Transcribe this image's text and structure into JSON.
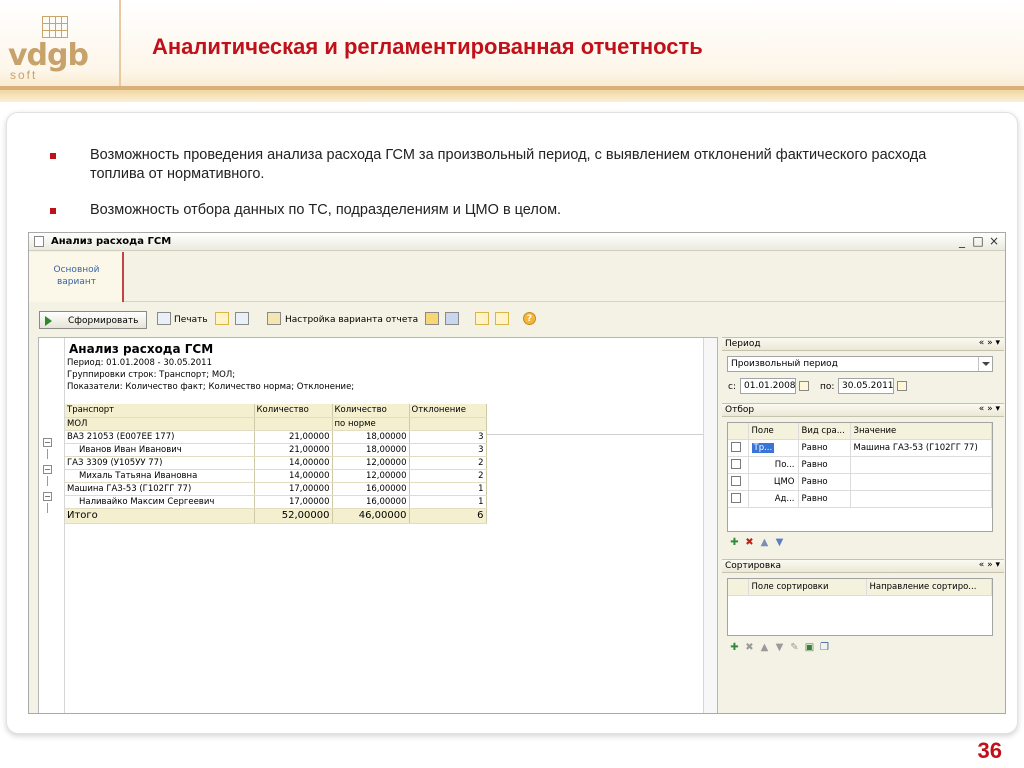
{
  "slide": {
    "title": "Аналитическая и регламентированная отчетность",
    "page_number": "36",
    "accent_color": "#c0111a",
    "logo": {
      "text": "vdgb",
      "sub": "soft"
    },
    "bullets": [
      "Возможность проведения анализа расхода ГСМ за произвольный период, с выявлением отклонений фактического расхода топлива от нормативного.",
      "Возможность отбора данных по ТС, подразделениям и ЦМО в целом."
    ]
  },
  "window": {
    "title": "Анализ расхода ГСМ",
    "controls": [
      "_",
      "□",
      "×"
    ],
    "variant_tab": {
      "line1": "Основной",
      "line2": "вариант"
    },
    "toolbar": {
      "generate": "Сформировать",
      "print": "Печать",
      "settings": "Настройка варианта отчета",
      "help": "?"
    }
  },
  "report": {
    "title": "Анализ расхода ГСМ",
    "meta": [
      "Период: 01.01.2008 - 30.05.2011",
      "Группировки строк: Транспорт; МОЛ;",
      "Показатели: Количество факт; Количество норма; Отклонение;"
    ],
    "header": {
      "col1_line1": "Транспорт",
      "col1_line2": "МОЛ",
      "col2_line1": "Количество",
      "col3_line1": "Количество",
      "col3_line2": "по норме",
      "col4_line1": "Отклонение"
    },
    "rows": [
      {
        "name": "ВАЗ 21053 (Е007ЕЕ 177)",
        "fact": "21,00000",
        "norm": "18,00000",
        "dev": "3"
      },
      {
        "name": "Иванов Иван Иванович",
        "fact": "21,00000",
        "norm": "18,00000",
        "dev": "3"
      },
      {
        "name": "ГАЗ 3309 (У105УУ 77)",
        "fact": "14,00000",
        "norm": "12,00000",
        "dev": "2"
      },
      {
        "name": "Михаль Татьяна Ивановна",
        "fact": "14,00000",
        "norm": "12,00000",
        "dev": "2"
      },
      {
        "name": "Машина ГАЗ-53 (Г102ГГ 77)",
        "fact": "17,00000",
        "norm": "16,00000",
        "dev": "1"
      },
      {
        "name": "Наливайко Максим Сергеевич",
        "fact": "17,00000",
        "norm": "16,00000",
        "dev": "1"
      }
    ],
    "total": {
      "name": "Итого",
      "fact": "52,00000",
      "norm": "46,00000",
      "dev": "6"
    }
  },
  "settings": {
    "period": {
      "title": "Период",
      "nav": "« » ▾",
      "type": "Произвольный период",
      "from_label": "с:",
      "from": "01.01.2008",
      "to_label": "по:",
      "to": "30.05.2011"
    },
    "filter": {
      "title": "Отбор",
      "nav": "« » ▾",
      "columns": [
        "Поле",
        "Вид сра...",
        "Значение"
      ],
      "rows": [
        {
          "field": "Тр...",
          "kind": "Равно",
          "value": "Машина ГАЗ-53 (Г102ГГ 77)"
        },
        {
          "field": "По...",
          "kind": "Равно",
          "value": ""
        },
        {
          "field": "ЦМО",
          "kind": "Равно",
          "value": ""
        },
        {
          "field": "Ад...",
          "kind": "Равно",
          "value": ""
        }
      ],
      "actions": [
        "add-icon",
        "delete-icon",
        "up-icon",
        "down-icon"
      ]
    },
    "sort": {
      "title": "Сортировка",
      "nav": "« » ▾",
      "columns": [
        "Поле сортировки",
        "Направление сортиро..."
      ],
      "actions": [
        "add-icon",
        "delete-icon",
        "up-icon",
        "down-icon",
        "edit-icon",
        "check-all-icon",
        "copy-icon"
      ]
    }
  }
}
